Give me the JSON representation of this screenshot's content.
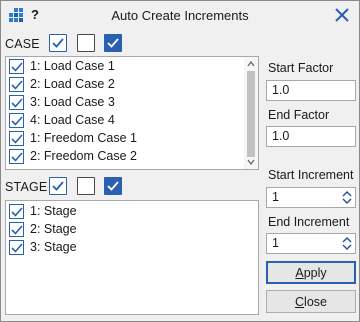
{
  "window": {
    "title": "Auto Create Increments",
    "help": "?"
  },
  "case": {
    "label": "CASE",
    "items": [
      "1: Load Case 1",
      "2: Load Case 2",
      "3: Load Case 3",
      "4: Load Case 4",
      "1: Freedom Case 1",
      "2: Freedom Case 2"
    ]
  },
  "stage": {
    "label": "STAGE",
    "items": [
      "1: Stage",
      "2: Stage",
      "3: Stage"
    ]
  },
  "right": {
    "start_factor_label": "Start Factor",
    "start_factor_value": "1.0",
    "end_factor_label": "End Factor",
    "end_factor_value": "1.0",
    "start_increment_label": "Start Increment",
    "start_increment_value": "1",
    "end_increment_label": "End Increment",
    "end_increment_value": "1"
  },
  "buttons": {
    "apply_first": "A",
    "apply_rest": "pply",
    "close_first": "C",
    "close_rest": "lose"
  },
  "colors": {
    "accent": "#2b5fb0"
  }
}
